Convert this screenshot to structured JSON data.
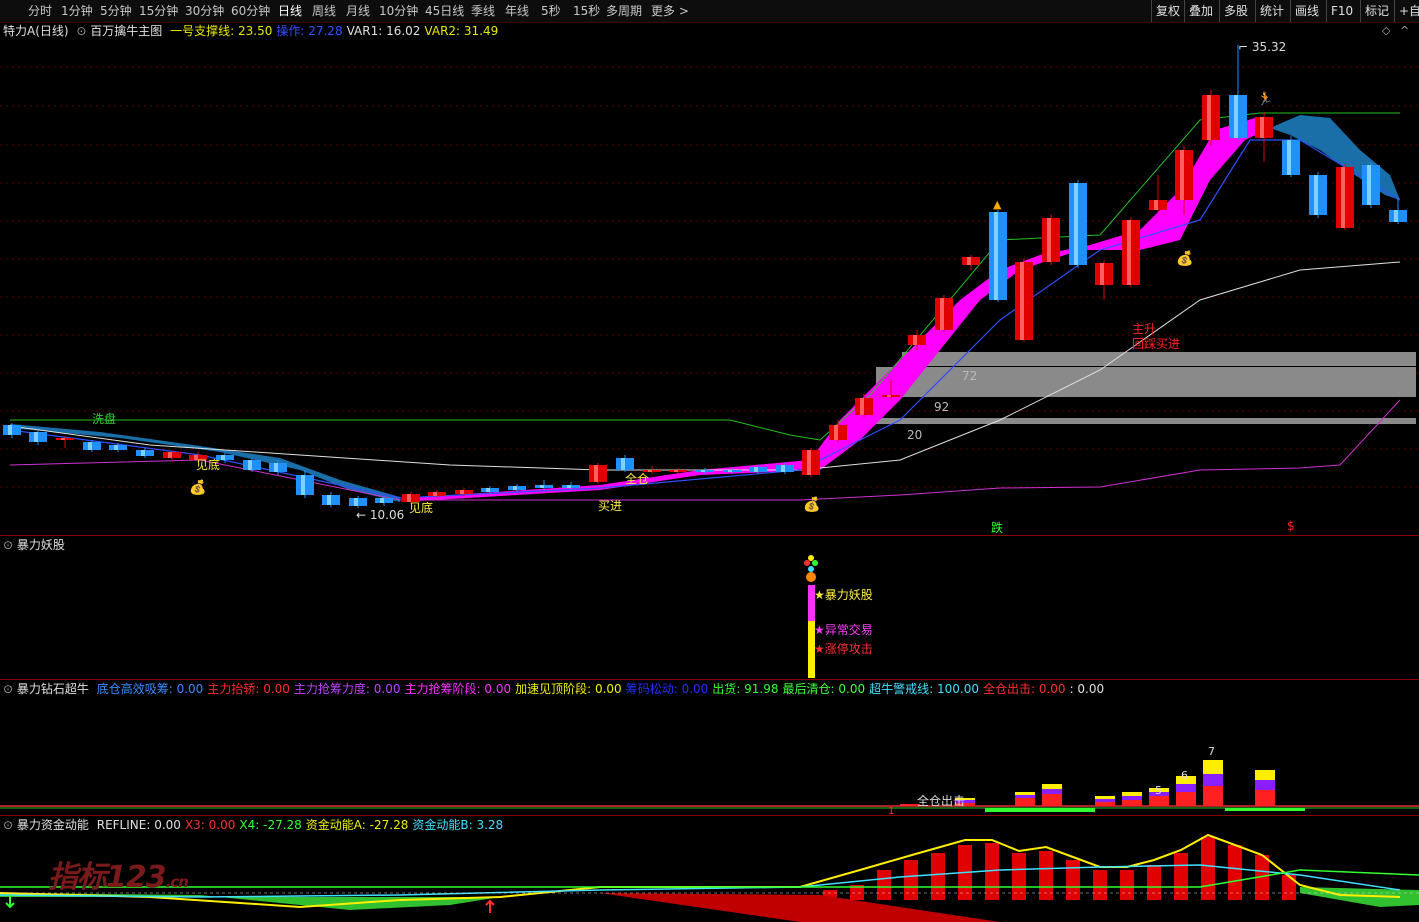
{
  "toolbar": {
    "periods": [
      "分时",
      "1分钟",
      "5分钟",
      "15分钟",
      "30分钟",
      "60分钟",
      "日线",
      "周线",
      "月线",
      "10分钟",
      "45日线",
      "季线",
      "年线",
      "5秒",
      "15秒",
      "多周期",
      "更多 >"
    ],
    "active": "日线",
    "right_buttons": [
      "复权",
      "叠加",
      "多股",
      "统计",
      "画线",
      "F10",
      "标记",
      "+自"
    ]
  },
  "main_panel": {
    "stock": "特力A(日线)",
    "indicator": "百万擒牛主图",
    "values": [
      {
        "label": "一号支撑线:",
        "value": "23.50",
        "color": "#e8e800"
      },
      {
        "label": "操作:",
        "value": "27.28",
        "color": "#3050ff"
      },
      {
        "label": "VAR1:",
        "value": "16.02",
        "color": "#e0e0e0"
      },
      {
        "label": "VAR2:",
        "value": "31.49",
        "color": "#e8e800"
      }
    ],
    "price_high": "35.32",
    "price_low": "10.06",
    "labels": {
      "xipan": "洗盘",
      "jiandi1": "见底",
      "jiandi2": "见底",
      "mairu": "买进",
      "quancang": "全仓",
      "zhusheng": "主升",
      "huicai": "回踩买进",
      "die": "跌",
      "box1": "72",
      "box2": "92",
      "box3": "20",
      "num15": "1"
    }
  },
  "panel2": {
    "title": "暴力妖股",
    "labels": [
      "暴力妖股",
      "异常交易",
      "涨停攻击"
    ]
  },
  "panel3": {
    "title": "暴力钻石超牛",
    "values": [
      {
        "label": "底仓高效吸筹:",
        "value": "0.00",
        "color": "#3a8cff"
      },
      {
        "label": "主力抬轿:",
        "value": "0.00",
        "color": "#ff2a2a"
      },
      {
        "label": "主力抢筹力度:",
        "value": "0.00",
        "color": "#c040ff"
      },
      {
        "label": "主力抢筹阶段:",
        "value": "0.00",
        "color": "#ff30ff"
      },
      {
        "label": "加速见顶阶段:",
        "value": "0.00",
        "color": "#f0f000"
      },
      {
        "label": "筹码松动:",
        "value": "0.00",
        "color": "#2030ff"
      },
      {
        "label": "出货:",
        "value": "91.98",
        "color": "#30ff30"
      },
      {
        "label": "最后清仓:",
        "value": "0.00",
        "color": "#40ff40"
      },
      {
        "label": "超牛警戒线:",
        "value": "100.00",
        "color": "#40e0ff"
      },
      {
        "label": "全仓出击:",
        "value": "0.00",
        "color": "#ff3030"
      },
      {
        "label": ":",
        "value": "0.00",
        "color": "#e0e0e0"
      }
    ],
    "bar_numbers": [
      "5",
      "6",
      "7"
    ],
    "label_quancang": "全仓出击",
    "num1": "1"
  },
  "panel4": {
    "title": "暴力资金动能",
    "values": [
      {
        "label": "REFLINE:",
        "value": "0.00",
        "color": "#e0e0e0"
      },
      {
        "label": "X3:",
        "value": "0.00",
        "color": "#ff3030"
      },
      {
        "label": "X4:",
        "value": "-27.28",
        "color": "#30ff30"
      },
      {
        "label": "资金动能A:",
        "value": "-27.28",
        "color": "#f0f000"
      },
      {
        "label": "资金动能B:",
        "value": "3.28",
        "color": "#40e0ff"
      }
    ],
    "watermark": "指标123",
    "watermark_suffix": ".cn"
  },
  "colors": {
    "up": "#e00000",
    "down": "#1e90ff",
    "band": "#ff00ff",
    "cloud": "#1a6fa8"
  }
}
